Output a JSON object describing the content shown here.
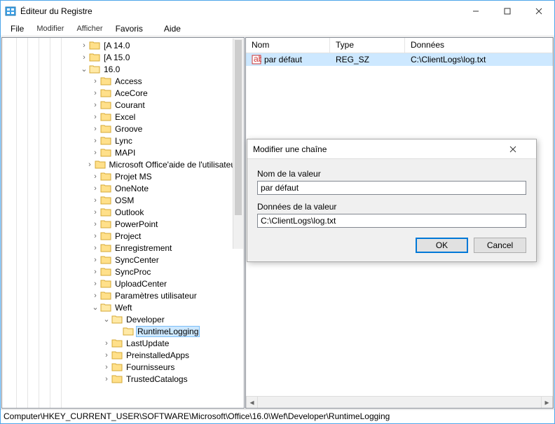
{
  "title": "Éditeur du Registre",
  "menu": {
    "file": "File",
    "edit": "Modifier",
    "view": "Afficher",
    "favorites": "Favoris",
    "help": "Aide"
  },
  "win_controls": {
    "min": "minimize",
    "max": "maximize",
    "close": "close"
  },
  "tree": {
    "items": [
      {
        "depth": 6,
        "toggle": ">",
        "label": "[A 14.0"
      },
      {
        "depth": 6,
        "toggle": ">",
        "label": "[A 15.0"
      },
      {
        "depth": 6,
        "toggle": "v",
        "label": "16.0"
      },
      {
        "depth": 7,
        "toggle": ">",
        "label": "Access"
      },
      {
        "depth": 7,
        "toggle": ">",
        "label": "AceCore"
      },
      {
        "depth": 7,
        "toggle": ">",
        "label": "Courant"
      },
      {
        "depth": 7,
        "toggle": ">",
        "label": "Excel"
      },
      {
        "depth": 7,
        "toggle": ">",
        "label": "Groove"
      },
      {
        "depth": 7,
        "toggle": ">",
        "label": "Lync"
      },
      {
        "depth": 7,
        "toggle": ">",
        "label": "MAPI"
      },
      {
        "depth": 7,
        "toggle": ">",
        "label": "Microsoft Office'aide de l'utilisateur"
      },
      {
        "depth": 7,
        "toggle": ">",
        "label": "Projet MS"
      },
      {
        "depth": 7,
        "toggle": ">",
        "label": "OneNote"
      },
      {
        "depth": 7,
        "toggle": ">",
        "label": "OSM"
      },
      {
        "depth": 7,
        "toggle": ">",
        "label": "Outlook"
      },
      {
        "depth": 7,
        "toggle": ">",
        "label": "PowerPoint"
      },
      {
        "depth": 7,
        "toggle": ">",
        "label": "Project"
      },
      {
        "depth": 7,
        "toggle": ">",
        "label": "Enregistrement"
      },
      {
        "depth": 7,
        "toggle": ">",
        "label": "SyncCenter"
      },
      {
        "depth": 7,
        "toggle": ">",
        "label": "SyncProc"
      },
      {
        "depth": 7,
        "toggle": ">",
        "label": "UploadCenter"
      },
      {
        "depth": 7,
        "toggle": ">",
        "label": "Paramètres utilisateur"
      },
      {
        "depth": 7,
        "toggle": "v",
        "label": "Weft"
      },
      {
        "depth": 8,
        "toggle": "v",
        "label": "Developer"
      },
      {
        "depth": 9,
        "toggle": "",
        "label": "RuntimeLogging",
        "selected": true
      },
      {
        "depth": 8,
        "toggle": ">",
        "label": "LastUpdate"
      },
      {
        "depth": 8,
        "toggle": ">",
        "label": "PreinstalledApps"
      },
      {
        "depth": 8,
        "toggle": ">",
        "label": "Fournisseurs"
      },
      {
        "depth": 8,
        "toggle": ">",
        "label": "TrustedCatalogs"
      }
    ]
  },
  "list": {
    "headers": {
      "name": "Nom",
      "type": "Type",
      "data": "Données"
    },
    "col_widths": {
      "name": 120,
      "type": 107,
      "data": 200
    },
    "rows": [
      {
        "name": "par défaut",
        "type": "REG_SZ",
        "data": "C:\\ClientLogs\\log.txt",
        "selected": true
      }
    ]
  },
  "dialog": {
    "title": "Modifier une chaîne",
    "name_label": "Nom de la valeur",
    "name_value": "par défaut",
    "data_label": "Données de la valeur",
    "data_value": "C:\\ClientLogs\\log.txt",
    "ok": "OK",
    "cancel": "Cancel"
  },
  "status": "Computer\\HKEY_CURRENT_USER\\SOFTWARE\\Microsoft\\Office\\16.0\\Wef\\Developer\\RuntimeLogging"
}
